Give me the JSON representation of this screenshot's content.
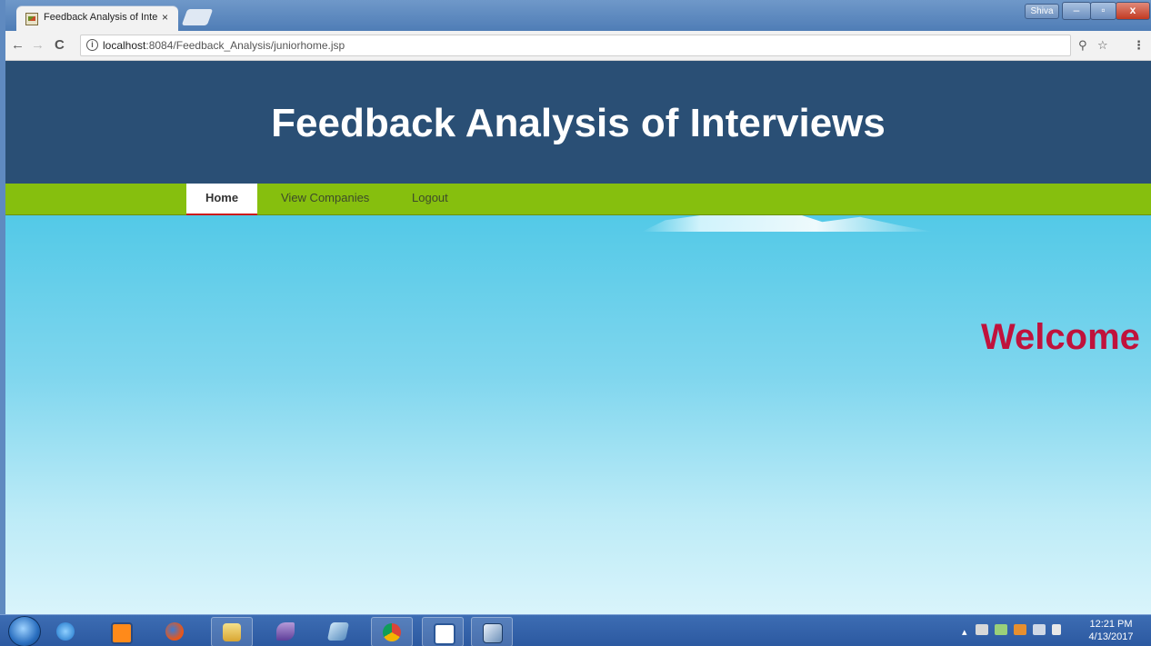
{
  "browser": {
    "tab_title": "Feedback Analysis of Inte",
    "tab_close": "×",
    "user_name": "Shiva",
    "url_host": "localhost",
    "url_rest": ":8084/Feedback_Analysis/juniorhome.jsp",
    "window_buttons": {
      "minimize": "–",
      "maximize": "▫",
      "close": "x"
    }
  },
  "site": {
    "title": "Feedback Analysis of Interviews",
    "welcome": "Welcome"
  },
  "nav": {
    "items": [
      {
        "label": "Home",
        "active": true
      },
      {
        "label": "View Companies",
        "active": false
      },
      {
        "label": "Logout",
        "active": false
      }
    ]
  },
  "taskbar": {
    "apps": [
      "start-orb",
      "internet-explorer-icon",
      "media-player-icon",
      "firefox-icon",
      "file-explorer-icon",
      "dolphin-app-icon",
      "notepad-icon",
      "chrome-icon",
      "word-icon",
      "virtualbox-icon"
    ],
    "clock_time": "12:21 PM",
    "clock_date": "4/13/2017"
  },
  "colors": {
    "header_bg": "#2a4f75",
    "nav_bg": "#86bf0e",
    "active_underline": "#cc1a1a",
    "welcome_text": "#c0123c"
  }
}
